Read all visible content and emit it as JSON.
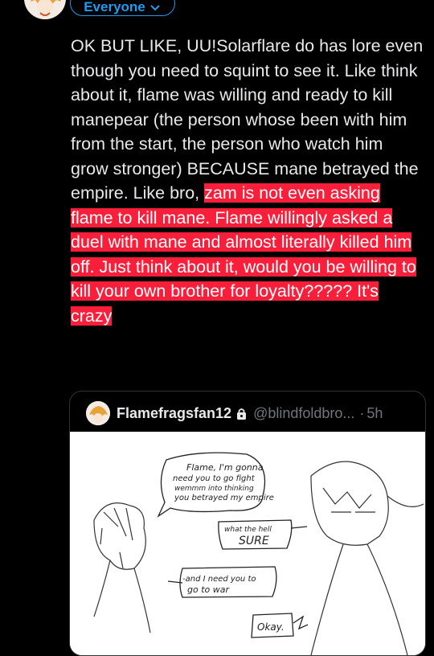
{
  "header": {
    "audience_label": "Everyone"
  },
  "post": {
    "text_plain_1": "OK BUT LIKE, UU!Solarflare do has lore even though you need to squint to see it. Like think about it, flame was willing and ready to kill manepear (the person whose been with him from the start, the person who watch him grow stronger) BECAUSE mane betrayed the empire. Like bro, ",
    "text_highlight": "zam is not even asking flame to kill mane. Flame willingly asked a duel with mane and almost literally killed him off. Just think about it, would you be willing to kill your own brother for loyalty????? It's crazy"
  },
  "quoted_post": {
    "display_name": "Flamefragsfan12",
    "handle": "@blindfoldbro...",
    "separator": "·",
    "time": "5h",
    "comic": {
      "bubble1_lines": [
        "Flame, I'm gonna",
        "need you to go fight",
        "wemmm into thinking",
        "you betrayed my empire"
      ],
      "bubble2_lines": [
        "what the hell",
        "SURE"
      ],
      "bubble3_lines": [
        "-and I need you to",
        "go to war"
      ],
      "bubble4_lines": [
        "Okay."
      ]
    }
  },
  "colors": {
    "background": "#000000",
    "text": "#e7e9ea",
    "accent": "#1d9bf0",
    "highlight": "#f91f3b",
    "muted": "#71767b"
  },
  "icons": {
    "audience": "chevron-down-icon",
    "lock": "lock-icon"
  }
}
